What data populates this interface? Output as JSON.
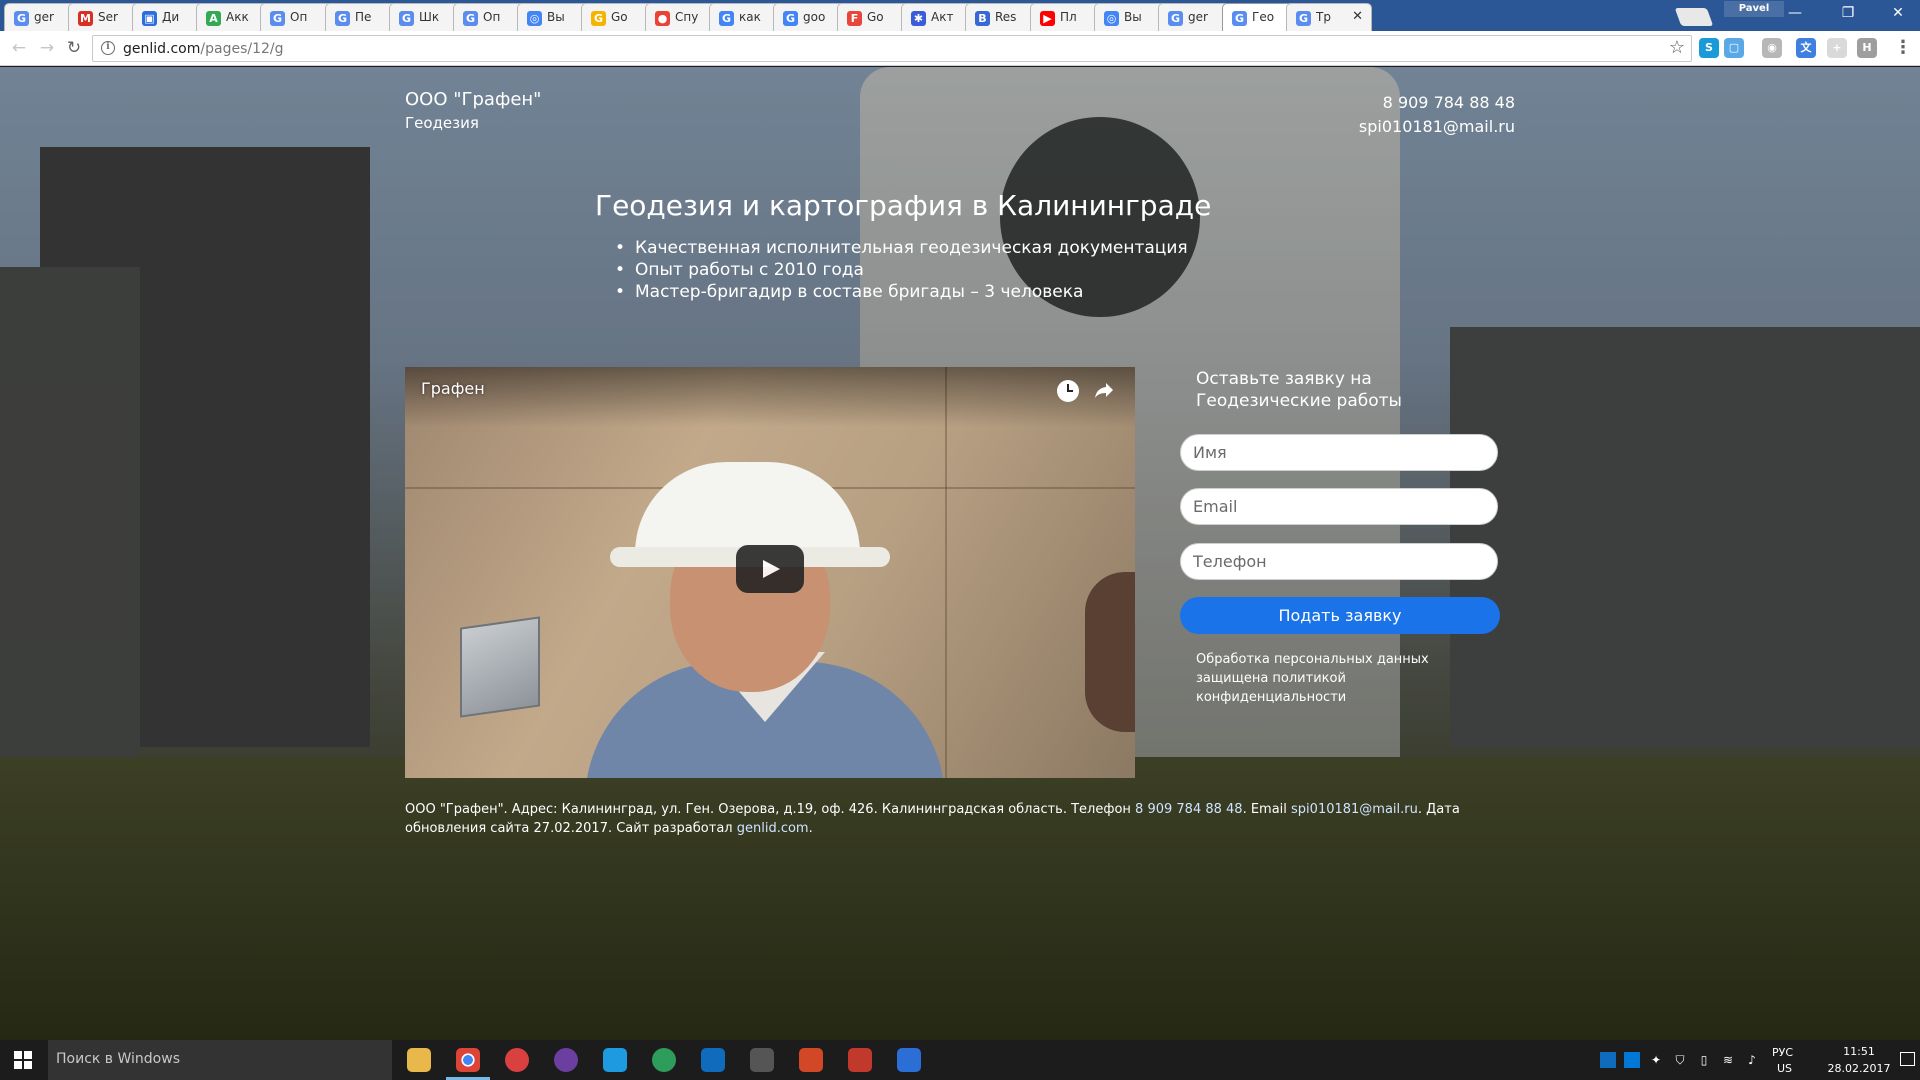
{
  "browser": {
    "tabs": [
      {
        "title": "ger",
        "favicon": "G",
        "color": "#5b8def"
      },
      {
        "title": "Ser",
        "favicon": "M",
        "color": "#d93025"
      },
      {
        "title": "Ди",
        "favicon": "▣",
        "color": "#2d6cdf"
      },
      {
        "title": "Акк",
        "favicon": "A",
        "color": "#34a853"
      },
      {
        "title": "Оп",
        "favicon": "G",
        "color": "#5b8def"
      },
      {
        "title": "Пе",
        "favicon": "G",
        "color": "#5b8def"
      },
      {
        "title": "Шк",
        "favicon": "G",
        "color": "#5b8def"
      },
      {
        "title": "Оп",
        "favicon": "G",
        "color": "#5b8def"
      },
      {
        "title": "Вы",
        "favicon": "◎",
        "color": "#4285f4"
      },
      {
        "title": "Go",
        "favicon": "G",
        "color": "#f4b400"
      },
      {
        "title": "Спу",
        "favicon": "●",
        "color": "#ea4335"
      },
      {
        "title": "как",
        "favicon": "G",
        "color": "#4285f4"
      },
      {
        "title": "goo",
        "favicon": "G",
        "color": "#4285f4"
      },
      {
        "title": "Go",
        "favicon": "F",
        "color": "#e8453c"
      },
      {
        "title": "Акт",
        "favicon": "✱",
        "color": "#3b5bdb"
      },
      {
        "title": "Res",
        "favicon": "B",
        "color": "#3867d6"
      },
      {
        "title": "Пл",
        "favicon": "▶",
        "color": "#ff0000"
      },
      {
        "title": "Вы",
        "favicon": "◎",
        "color": "#4285f4"
      },
      {
        "title": "ger",
        "favicon": "G",
        "color": "#5b8def"
      },
      {
        "title": "Гео",
        "favicon": "G",
        "color": "#5b8def",
        "active": true
      },
      {
        "title": "Тр",
        "favicon": "G",
        "color": "#5b8def"
      }
    ],
    "profile_name": "Pavel",
    "url_host": "genlid.com",
    "url_path": "/pages/12/g"
  },
  "header": {
    "company": "ООО \"Графен\"",
    "subtitle": "Геодезия",
    "phone": "8 909 784 88 48",
    "email": "spi010181@mail.ru"
  },
  "hero": {
    "title": "Геодезия и картография в Калининграде",
    "bullets": [
      "Качественная исполнительная геодезическая документация",
      "Опыт работы с 2010 года",
      "Мастер-бригадир в составе бригады – 3 человека"
    ]
  },
  "video": {
    "title": "Графен"
  },
  "form": {
    "title_line1": "Оставьте заявку на",
    "title_line2": "Геодезические работы",
    "name_placeholder": "Имя",
    "email_placeholder": "Email",
    "phone_placeholder": "Телефон",
    "submit_label": "Подать заявку",
    "privacy_text": "Обработка персональных данных защищена политикой конфиденциальности"
  },
  "footer": {
    "text_before_phone": "ООО \"Графен\". Адрес: Калининград, ул. Ген. Озерова, д.19, оф. 426. Калининградская область. Телефон ",
    "phone_link": "8 909 784 88 48",
    "text_before_email": ". Email ",
    "email_link": "spi010181@mail.ru",
    "text_after_email": ". Дата обновления сайта 27.02.2017. Сайт разработал ",
    "developer_link": "genlid.com",
    "text_end": "."
  },
  "taskbar": {
    "search_placeholder": "Поиск в Windows",
    "lang_line1": "РУС",
    "lang_line2": "US",
    "time": "11:51",
    "date": "28.02.2017"
  }
}
